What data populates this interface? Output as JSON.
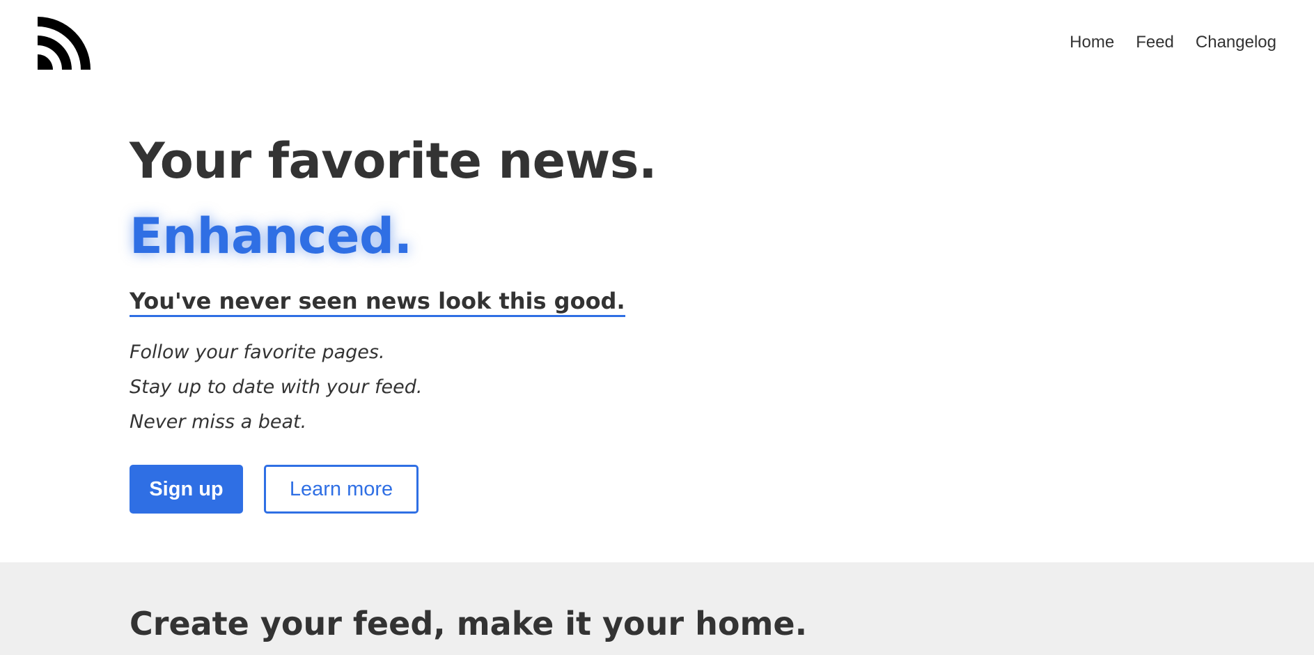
{
  "header": {
    "logo_icon": "rss-icon",
    "nav": [
      {
        "label": "Home"
      },
      {
        "label": "Feed"
      },
      {
        "label": "Changelog"
      }
    ]
  },
  "hero": {
    "title": "Your favorite news.",
    "highlight": "Enhanced.",
    "tagline": "You've never seen news look this good.",
    "lines": [
      "Follow your favorite pages.",
      "Stay up to date with your feed.",
      "Never miss a beat."
    ],
    "primary_button": "Sign up",
    "secondary_button": "Learn more"
  },
  "section": {
    "title": "Create your feed, make it your home."
  },
  "colors": {
    "accent": "#2f6fe4",
    "text": "#333333",
    "section_bg": "#efefef"
  }
}
